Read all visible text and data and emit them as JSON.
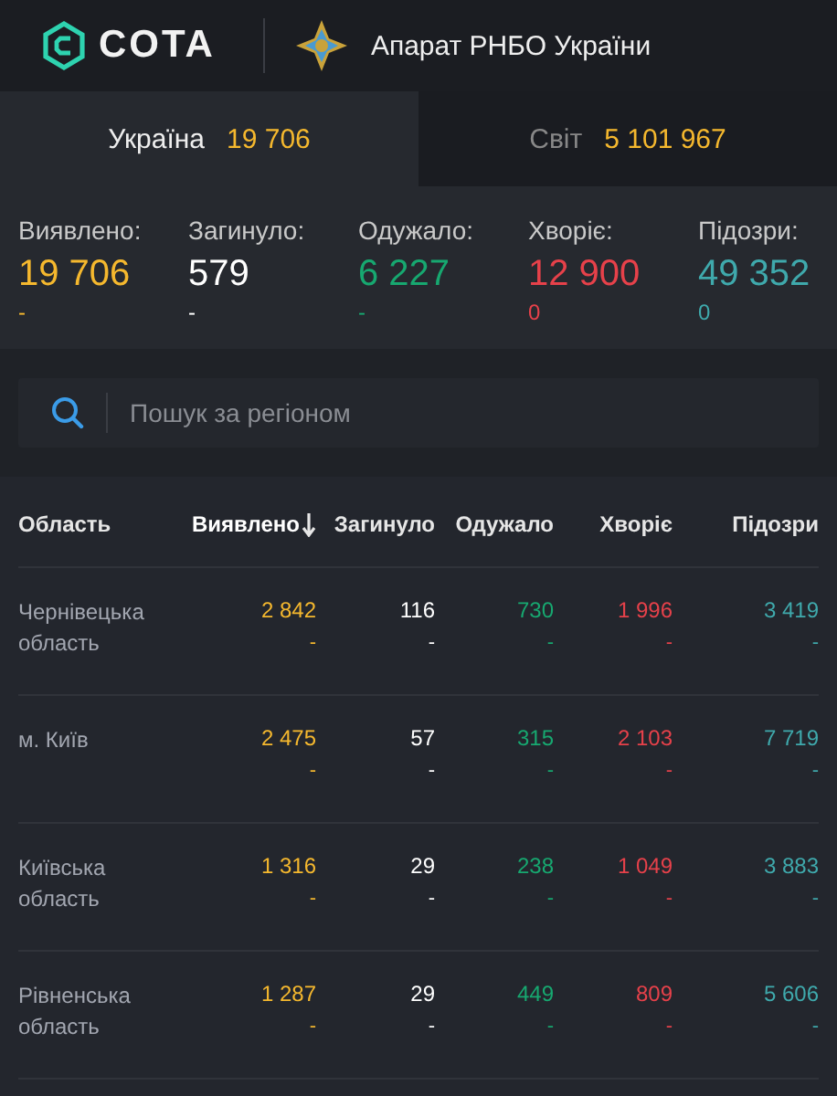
{
  "header": {
    "brand": "COTA",
    "organization": "Апарат РНБО України"
  },
  "tabs": [
    {
      "label": "Україна",
      "count": "19 706",
      "selected": true
    },
    {
      "label": "Світ",
      "count": "5 101 967",
      "selected": false
    }
  ],
  "stats": [
    {
      "label": "Виявлено:",
      "value": "19 706",
      "delta": "-",
      "color": "#f5b82e"
    },
    {
      "label": "Загинуло:",
      "value": "579",
      "delta": "-",
      "color": "#ffffff"
    },
    {
      "label": "Одужало:",
      "value": "6 227",
      "delta": "-",
      "color": "#17a870"
    },
    {
      "label": "Хворіє:",
      "value": "12 900",
      "delta": "0",
      "color": "#e6414a"
    },
    {
      "label": "Підозри:",
      "value": "49 352",
      "delta": "0",
      "color": "#3fa9ac"
    }
  ],
  "search": {
    "placeholder": "Пошук за регіоном"
  },
  "table": {
    "region_column": "Область",
    "columns": [
      {
        "label": "Виявлено",
        "sorted": true,
        "color": "#f5b82e"
      },
      {
        "label": "Загинуло",
        "sorted": false,
        "color": "#ffffff"
      },
      {
        "label": "Одужало",
        "sorted": false,
        "color": "#17a870"
      },
      {
        "label": "Хворіє",
        "sorted": false,
        "color": "#e6414a"
      },
      {
        "label": "Підозри",
        "sorted": false,
        "color": "#3fa9ac"
      }
    ],
    "rows": [
      {
        "region": "Чернівецька область",
        "cells": [
          {
            "value": "2 842",
            "delta": "-"
          },
          {
            "value": "116",
            "delta": "-"
          },
          {
            "value": "730",
            "delta": "-"
          },
          {
            "value": "1 996",
            "delta": "-"
          },
          {
            "value": "3 419",
            "delta": "-"
          }
        ]
      },
      {
        "region": "м. Київ",
        "cells": [
          {
            "value": "2 475",
            "delta": "-"
          },
          {
            "value": "57",
            "delta": "-"
          },
          {
            "value": "315",
            "delta": "-"
          },
          {
            "value": "2 103",
            "delta": "-"
          },
          {
            "value": "7 719",
            "delta": "-"
          }
        ]
      },
      {
        "region": "Київська область",
        "cells": [
          {
            "value": "1 316",
            "delta": "-"
          },
          {
            "value": "29",
            "delta": "-"
          },
          {
            "value": "238",
            "delta": "-"
          },
          {
            "value": "1 049",
            "delta": "-"
          },
          {
            "value": "3 883",
            "delta": "-"
          }
        ]
      },
      {
        "region": "Рівненська область",
        "cells": [
          {
            "value": "1 287",
            "delta": "-"
          },
          {
            "value": "29",
            "delta": "-"
          },
          {
            "value": "449",
            "delta": "-"
          },
          {
            "value": "809",
            "delta": "-"
          },
          {
            "value": "5 606",
            "delta": "-"
          }
        ]
      }
    ]
  }
}
